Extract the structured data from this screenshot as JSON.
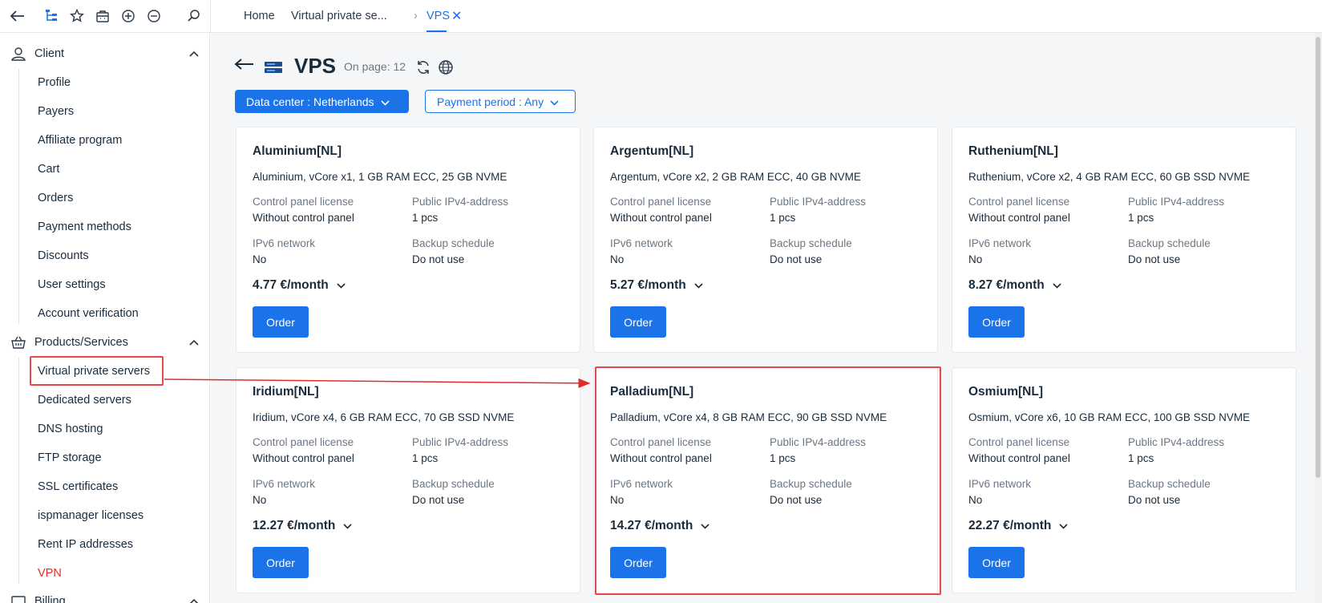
{
  "topbar": {
    "icons": [
      "back-icon",
      "sitemap-icon",
      "star-icon",
      "briefcase-icon",
      "zoom-in-icon",
      "zoom-out-icon",
      "search-icon"
    ],
    "breadcrumbs": [
      "Home",
      "Virtual private se...",
      "VPS"
    ]
  },
  "sidebar": {
    "sections": [
      {
        "title": "Client",
        "icon": "user-icon",
        "items": [
          "Profile",
          "Payers",
          "Affiliate program",
          "Cart",
          "Orders",
          "Payment methods",
          "Discounts",
          "User settings",
          "Account verification"
        ]
      },
      {
        "title": "Products/Services",
        "icon": "basket-icon",
        "items": [
          "Virtual private servers",
          "Dedicated servers",
          "DNS hosting",
          "FTP storage",
          "SSL certificates",
          "ispmanager licenses",
          "Rent IP addresses",
          "VPN"
        ]
      },
      {
        "title": "Billing",
        "icon": "billing-icon",
        "items": []
      }
    ]
  },
  "main": {
    "title": "VPS",
    "on_page": "On page: 12",
    "filters": {
      "datacenter": "Data center : Netherlands",
      "payment": "Payment period : Any"
    },
    "cards": [
      {
        "name": "Aluminium[NL]",
        "desc": "Aluminium, vCore x1, 1 GB RAM ECC, 25 GB NVME",
        "cp_label": "Control panel license",
        "cp_value": "Without control panel",
        "ip_label": "Public IPv4-address",
        "ip_value": "1 pcs",
        "v6_label": "IPv6 network",
        "v6_value": "No",
        "bk_label": "Backup schedule",
        "bk_value": "Do not use",
        "price": "4.77 €/month",
        "order": "Order"
      },
      {
        "name": "Argentum[NL]",
        "desc": "Argentum, vCore x2, 2 GB RAM ECC, 40 GB NVME",
        "cp_label": "Control panel license",
        "cp_value": "Without control panel",
        "ip_label": "Public IPv4-address",
        "ip_value": "1 pcs",
        "v6_label": "IPv6 network",
        "v6_value": "No",
        "bk_label": "Backup schedule",
        "bk_value": "Do not use",
        "price": "5.27 €/month",
        "order": "Order"
      },
      {
        "name": "Ruthenium[NL]",
        "desc": "Ruthenium, vCore x2, 4 GB RAM ECC, 60 GB SSD NVME",
        "cp_label": "Control panel license",
        "cp_value": "Without control panel",
        "ip_label": "Public IPv4-address",
        "ip_value": "1 pcs",
        "v6_label": "IPv6 network",
        "v6_value": "No",
        "bk_label": "Backup schedule",
        "bk_value": "Do not use",
        "price": "8.27 €/month",
        "order": "Order"
      },
      {
        "name": "Iridium[NL]",
        "desc": "Iridium, vCore x4, 6 GB RAM ECC, 70 GB SSD NVME",
        "cp_label": "Control panel license",
        "cp_value": "Without control panel",
        "ip_label": "Public IPv4-address",
        "ip_value": "1 pcs",
        "v6_label": "IPv6 network",
        "v6_value": "No",
        "bk_label": "Backup schedule",
        "bk_value": "Do not use",
        "price": "12.27 €/month",
        "order": "Order"
      },
      {
        "name": "Palladium[NL]",
        "desc": "Palladium, vCore x4, 8 GB RAM ECC, 90 GB SSD NVME",
        "cp_label": "Control panel license",
        "cp_value": "Without control panel",
        "ip_label": "Public IPv4-address",
        "ip_value": "1 pcs",
        "v6_label": "IPv6 network",
        "v6_value": "No",
        "bk_label": "Backup schedule",
        "bk_value": "Do not use",
        "price": "14.27 €/month",
        "order": "Order"
      },
      {
        "name": "Osmium[NL]",
        "desc": "Osmium, vCore x6, 10 GB RAM ECC, 100 GB SSD NVME",
        "cp_label": "Control panel license",
        "cp_value": "Without control panel",
        "ip_label": "Public IPv4-address",
        "ip_value": "1 pcs",
        "v6_label": "IPv6 network",
        "v6_value": "No",
        "bk_label": "Backup schedule",
        "bk_value": "Do not use",
        "price": "22.27 €/month",
        "order": "Order"
      }
    ]
  },
  "colors": {
    "accent": "#1a73e8",
    "highlight": "#e8484a",
    "vpn_text": "#e02b2b",
    "background": "#f5f6f8"
  }
}
